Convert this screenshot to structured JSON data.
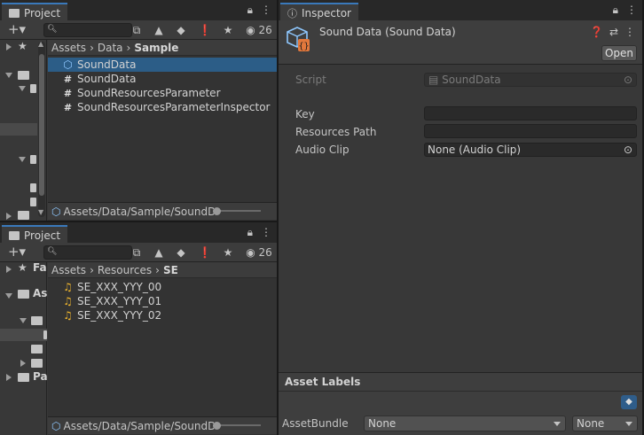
{
  "project_top": {
    "tab_label": "Project",
    "badge_count": "26",
    "breadcrumb": [
      "Assets",
      "Data",
      "Sample"
    ],
    "files": [
      {
        "name": "SoundData",
        "icon": "scriptable-object-icon",
        "selected": true
      },
      {
        "name": "SoundData",
        "icon": "cs-script-icon",
        "selected": false
      },
      {
        "name": "SoundResourcesParameter",
        "icon": "cs-script-icon",
        "selected": false
      },
      {
        "name": "SoundResourcesParameterInspector",
        "icon": "cs-script-icon",
        "selected": false
      }
    ],
    "status_path": "Assets/Data/Sample/SoundDa"
  },
  "project_bottom": {
    "tab_label": "Project",
    "badge_count": "26",
    "breadcrumb": [
      "Assets",
      "Resources",
      "SE"
    ],
    "tree_labels": [
      "Fa",
      "As",
      "Pa"
    ],
    "files": [
      {
        "name": "SE_XXX_YYY_00",
        "icon": "audio-clip-icon"
      },
      {
        "name": "SE_XXX_YYY_01",
        "icon": "audio-clip-icon"
      },
      {
        "name": "SE_XXX_YYY_02",
        "icon": "audio-clip-icon"
      }
    ],
    "status_path": "Assets/Data/Sample/SoundDa"
  },
  "inspector": {
    "tab_label": "Inspector",
    "title": "Sound Data (Sound Data)",
    "open_label": "Open",
    "script_label": "Script",
    "script_value": "SoundData",
    "properties": [
      {
        "label": "Key",
        "value": ""
      },
      {
        "label": "Resources Path",
        "value": ""
      },
      {
        "label": "Audio Clip",
        "value": "None (Audio Clip)"
      }
    ],
    "asset_labels_title": "Asset Labels",
    "assetbundle_label": "AssetBundle",
    "assetbundle_value": "None",
    "assetbundle_variant": "None"
  },
  "colors": {
    "selection": "#2c5d87",
    "accent_tab": "#3a79bb",
    "audio_icon": "#f1b72e",
    "script_badge": "#e2783c"
  }
}
